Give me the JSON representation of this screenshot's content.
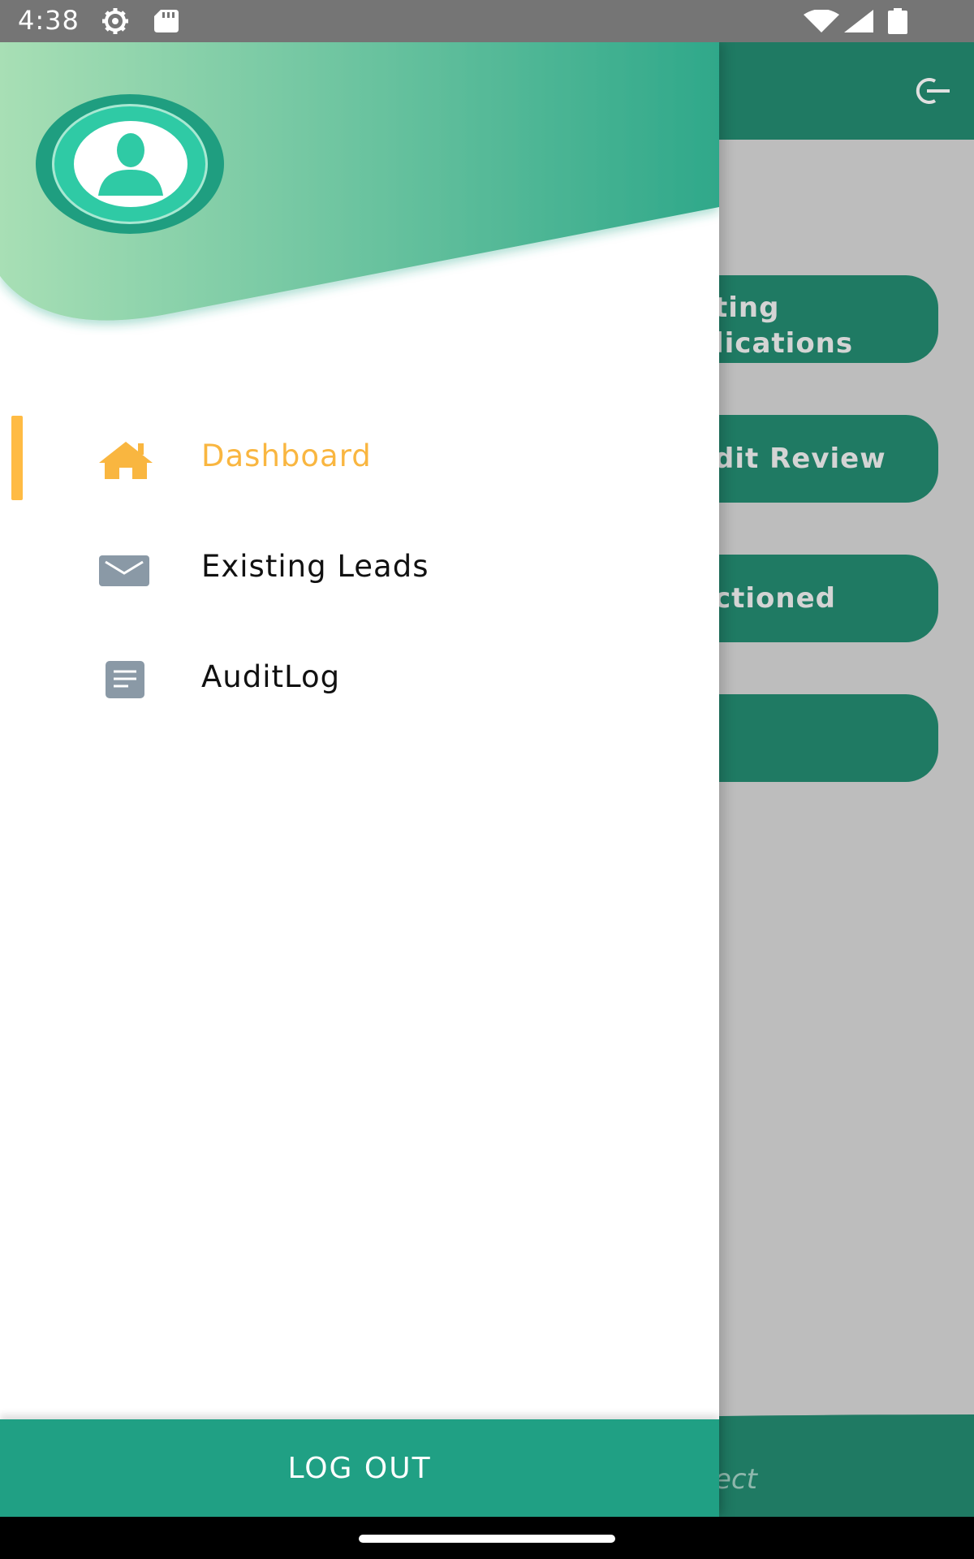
{
  "status_bar": {
    "time": "4:38",
    "icons": [
      "settings-gear-icon",
      "sd-card-icon",
      "wifi-icon",
      "cell-signal-icon",
      "battery-icon"
    ]
  },
  "background_app": {
    "logout_icon": "logout-icon",
    "cards": [
      {
        "label": "ting\nlications"
      },
      {
        "label": "dit Review"
      },
      {
        "label": "ctioned"
      },
      {
        "label": ""
      }
    ],
    "footer_text": "ect"
  },
  "drawer": {
    "avatar_icon": "user-avatar-icon",
    "menu": [
      {
        "label": "Dashboard",
        "icon": "home-icon",
        "active": true
      },
      {
        "label": "Existing Leads",
        "icon": "mail-icon",
        "active": false
      },
      {
        "label": "AuditLog",
        "icon": "document-icon",
        "active": false
      }
    ],
    "logout_label": "LOG OUT"
  },
  "colors": {
    "primary": "#20A084",
    "primary_dark": "#1F7A63",
    "accent": "#F9B640",
    "header_gradient_start": "#A8DFB5",
    "header_gradient_end": "#2FA88A",
    "icon_gray": "#8A99A6"
  }
}
